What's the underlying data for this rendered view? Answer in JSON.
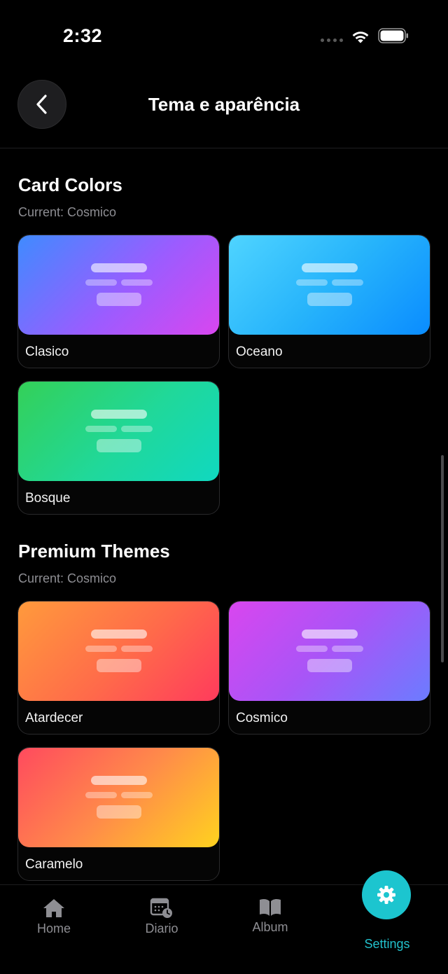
{
  "status": {
    "time": "2:32"
  },
  "header": {
    "title": "Tema e aparência"
  },
  "card_colors": {
    "title": "Card Colors",
    "current": "Current: Cosmico",
    "items": [
      {
        "label": "Clasico"
      },
      {
        "label": "Oceano"
      },
      {
        "label": "Bosque"
      }
    ]
  },
  "premium_themes": {
    "title": "Premium Themes",
    "current": "Current: Cosmico",
    "items": [
      {
        "label": "Atardecer"
      },
      {
        "label": "Cosmico"
      },
      {
        "label": "Caramelo"
      }
    ]
  },
  "tabs": {
    "home": "Home",
    "diario": "Diario",
    "album": "Album",
    "settings": "Settings"
  },
  "colors": {
    "accent": "#1cc5cf",
    "background": "#000000",
    "inactive": "#8e8e93"
  },
  "icons": {
    "back": "chevron-left-icon",
    "home": "house-icon",
    "diario": "calendar-clock-icon",
    "album": "book-open-icon",
    "settings": "gear-icon"
  }
}
